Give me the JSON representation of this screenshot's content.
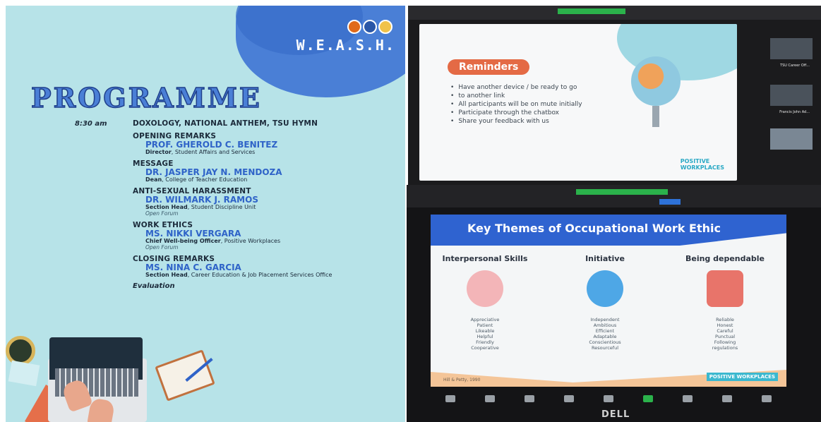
{
  "poster": {
    "brand": "W.E.A.S.H.",
    "title": "PROGRAMME",
    "time": "8:30 am",
    "opening": "DOXOLOGY, NATIONAL ANTHEM, TSU HYMN",
    "items": [
      {
        "head": "OPENING REMARKS",
        "name": "PROF. GHEROLD C. BENITEZ",
        "role_bold": "Director",
        "role_rest": ", Student Affairs and Services",
        "sub": ""
      },
      {
        "head": "MESSAGE",
        "name": "DR. JASPER JAY N. MENDOZA",
        "role_bold": "Dean",
        "role_rest": ", College of Teacher Education",
        "sub": ""
      },
      {
        "head": "ANTI-SEXUAL HARASSMENT",
        "name": "DR. WILMARK J. RAMOS",
        "role_bold": "Section Head",
        "role_rest": ", Student Discipline Unit",
        "sub": "Open Forum"
      },
      {
        "head": "WORK ETHICS",
        "name": "MS. NIKKI VERGARA",
        "role_bold": "Chief Well-being Officer",
        "role_rest": ", Positive Workplaces",
        "sub": "Open Forum"
      },
      {
        "head": "CLOSING REMARKS",
        "name": "MS. NINA C. GARCIA",
        "role_bold": "Section Head",
        "role_rest": ", Career Education & Job Placement Services Office",
        "sub": ""
      }
    ],
    "evaluation": "Evaluation"
  },
  "zoom1": {
    "slide_pill": "Reminders",
    "reminders": [
      "Have another device / be ready to go",
      "to another link",
      "All participants will be on mute initially",
      "Participate through the chatbox",
      "Share your feedback with us"
    ],
    "logo_top": "POSITIVE",
    "logo_bottom": "WORKPLACES",
    "participants": [
      "TSU Career Off...",
      "Francis John Ad..."
    ]
  },
  "zoom2": {
    "slide_title": "Key Themes of Occupational Work Ethic",
    "columns": [
      {
        "title": "Interpersonal Skills",
        "items": [
          "Appreciative",
          "Patient",
          "Likeable",
          "Helpful",
          "Friendly",
          "Cooperative"
        ]
      },
      {
        "title": "Initiative",
        "items": [
          "Independent",
          "Ambitious",
          "Efficient",
          "Adaptable",
          "Conscientious",
          "Resourceful"
        ]
      },
      {
        "title": "Being dependable",
        "items": [
          "Reliable",
          "Honest",
          "Careful",
          "Punctual",
          "Following",
          "regulations"
        ]
      }
    ],
    "citation": "Hill & Petty, 1990",
    "logo": "POSITIVE WORKPLACES",
    "brand": "DELL"
  }
}
